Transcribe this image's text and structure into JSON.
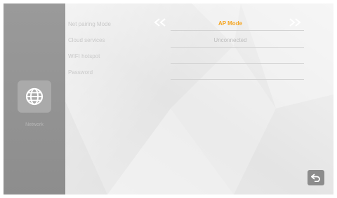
{
  "sidebar": {
    "item": {
      "label": "Network",
      "icon": "globe-icon"
    }
  },
  "rows": [
    {
      "label": "Net pairing Mode",
      "value": "AP Mode"
    },
    {
      "label": "Cloud services",
      "value": "Unconnected"
    },
    {
      "label": "WIFI hotspot",
      "value": ""
    },
    {
      "label": "Password",
      "value": ""
    }
  ],
  "colors": {
    "accent": "#f5a623",
    "sidebar": "#959595",
    "label": "#c9c9c9"
  },
  "icons": {
    "prev": "chevron-left-double-icon",
    "next": "chevron-right-double-icon",
    "back": "back-arrow-icon"
  }
}
